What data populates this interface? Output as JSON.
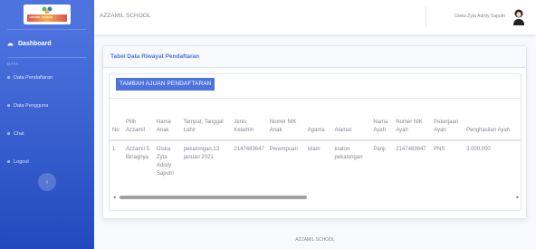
{
  "sidebar": {
    "logo_text": "AZZAMIL SCHOOL",
    "dashboard_label": "Dashboard",
    "section_heading": "DATA",
    "items": [
      {
        "label": "Data Pendaftaran"
      },
      {
        "label": "Data Pengguna"
      },
      {
        "label": "Chat"
      },
      {
        "label": "Logout"
      }
    ],
    "toggle_symbol": "‹"
  },
  "topbar": {
    "school_name": "AZZAMIL SCHOOL",
    "user_name": "Giska Zyta Adisty Saputri"
  },
  "card": {
    "title": "Tabel Data Riwayat Pendaftaran",
    "add_button": "TAMBAH AJUAN PENDAFTARAN"
  },
  "table": {
    "headers": [
      "No",
      "Pilih Azzamil",
      "Nama Anak",
      "Tempat, Tanggal Lahir",
      "Jenis Kelamin",
      "Nomer NIK Anak",
      "Agama",
      "Alamat",
      "Nama Ayah",
      "Nomer NIK Ayah",
      "Pekerjaan Ayah",
      "Penghasilan Ayah"
    ],
    "rows": [
      [
        "1",
        "Azzamil 5 Binagriya",
        "Giska Zyta Adisty Saputri",
        "pekalongan,13 januari 2021",
        "2147483647",
        "Perempuan",
        "islam",
        "kraton pekalongan",
        "Panji",
        "2147483647",
        "PNS",
        "3.000,000"
      ]
    ]
  },
  "scroll": {
    "left_arrow": "◂",
    "right_arrow": "▸"
  },
  "footer": {
    "text": "AZZAMIL SCHOOL"
  },
  "colors": {
    "primary": "#4e73df",
    "sidebar_end": "#224abe"
  }
}
